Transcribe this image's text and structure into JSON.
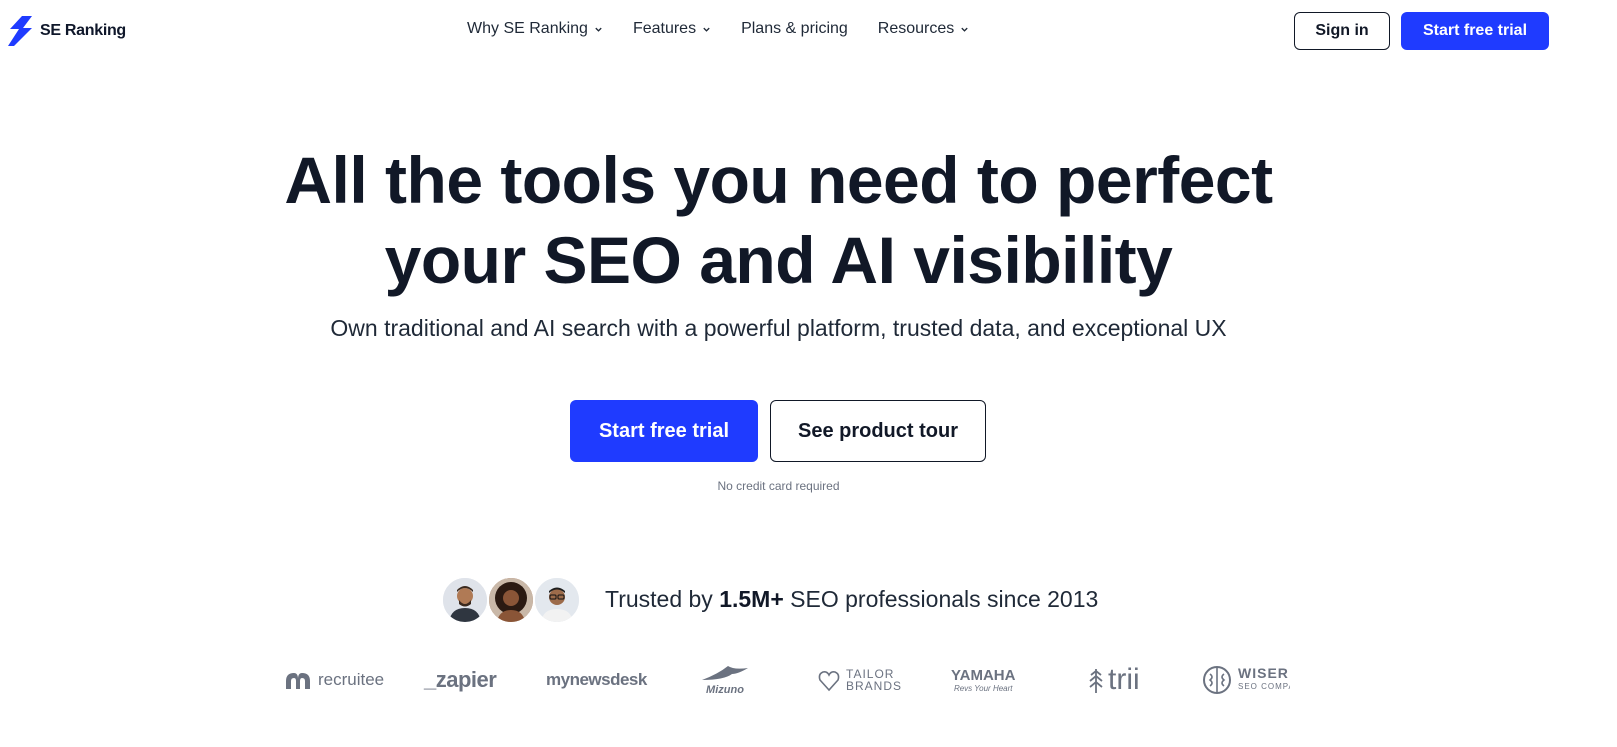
{
  "header": {
    "brand": "SE Ranking",
    "nav": [
      {
        "label": "Why SE Ranking",
        "has_dropdown": true
      },
      {
        "label": "Features",
        "has_dropdown": true
      },
      {
        "label": "Plans & pricing",
        "has_dropdown": false
      },
      {
        "label": "Resources",
        "has_dropdown": true
      }
    ],
    "signin_label": "Sign in",
    "trial_label": "Start free trial"
  },
  "hero": {
    "title_line1": "All the tools you need to perfect",
    "title_line2": "your SEO and AI visibility",
    "subtitle": "Own traditional and AI search with a powerful platform, trusted data, and exceptional UX",
    "primary_cta": "Start free trial",
    "secondary_cta": "See product tour",
    "note": "No credit card required"
  },
  "trust": {
    "prefix": "Trusted by",
    "count": "1.5M+",
    "suffix": "SEO professionals since 2013"
  },
  "logos": {
    "recruitee": "recruitee",
    "zapier": "_zapier",
    "mynewsdesk": "mynewsdesk",
    "mizuno": "Mizuno",
    "tailor_1": "TAILOR",
    "tailor_2": "BRANDS",
    "yamaha": "YAMAHA",
    "yamaha_tag": "Revs Your Heart",
    "trii": "trii",
    "wiser_1": "WISER I",
    "wiser_2": "SEO COMPA"
  },
  "colors": {
    "accent": "#1f3bff",
    "text": "#111827",
    "muted": "#6b7280"
  }
}
